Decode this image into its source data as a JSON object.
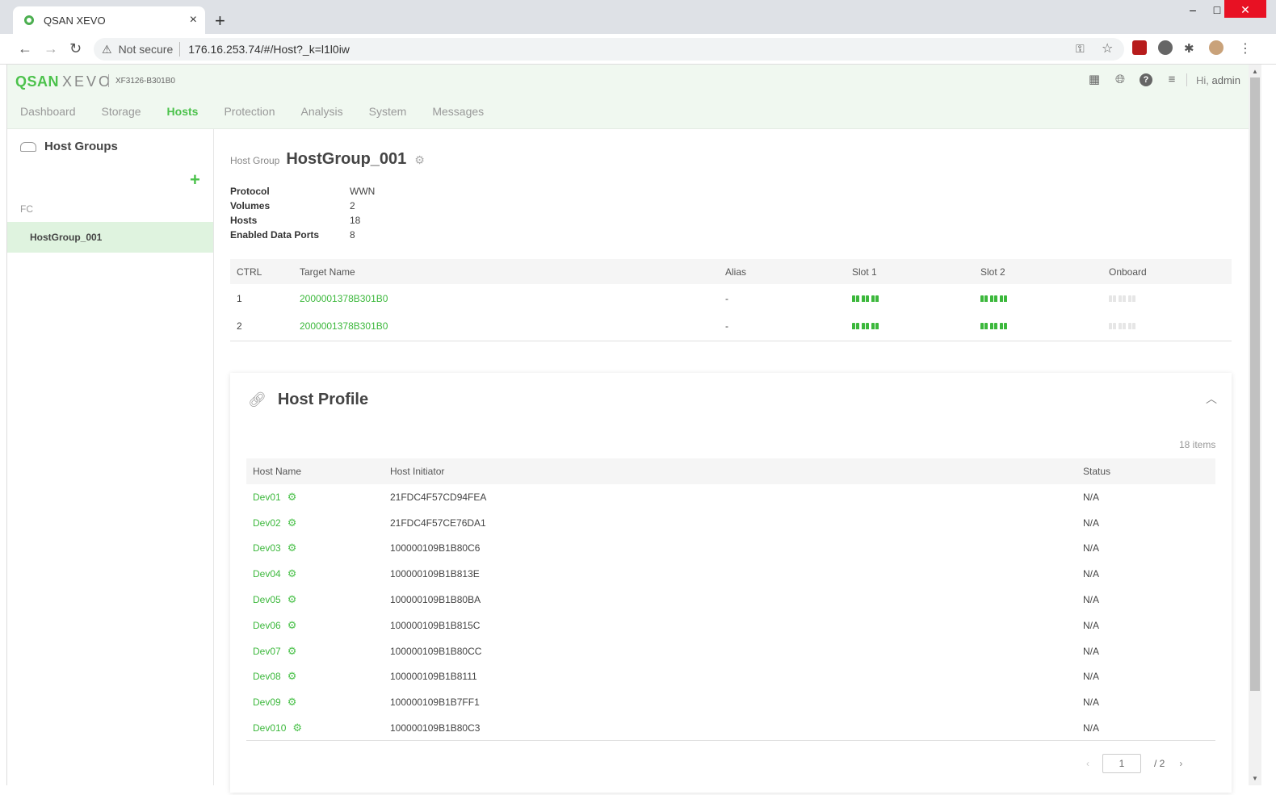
{
  "browser": {
    "tab_title": "QSAN XEVO",
    "new_tab": "+",
    "security": "Not secure",
    "url": "176.16.253.74/#/Host?_k=l1l0iw",
    "window_minimize": "–",
    "window_maximize": "□",
    "window_close": "✕"
  },
  "app": {
    "logo_brand": "QSAN",
    "logo_product": "XEVO",
    "model": "XF3126-B301B0",
    "greeting_prefix": "Hi,",
    "user": "admin",
    "nav": [
      "Dashboard",
      "Storage",
      "Hosts",
      "Protection",
      "Analysis",
      "System",
      "Messages"
    ],
    "active_nav": "Hosts",
    "accent_color": "#4cc24c"
  },
  "sidebar": {
    "title": "Host Groups",
    "add_label": "+",
    "section": "FC",
    "items": [
      {
        "label": "HostGroup_001",
        "selected": true
      }
    ]
  },
  "host_group": {
    "label": "Host Group",
    "name": "HostGroup_001",
    "properties": [
      {
        "key": "Protocol",
        "value": "WWN"
      },
      {
        "key": "Volumes",
        "value": "2"
      },
      {
        "key": "Hosts",
        "value": "18"
      },
      {
        "key": "Enabled Data Ports",
        "value": "8"
      }
    ]
  },
  "ctrl_table": {
    "headers": [
      "CTRL",
      "Target Name",
      "Alias",
      "Slot 1",
      "Slot 2",
      "Onboard"
    ],
    "rows": [
      {
        "ctrl": "1",
        "target": "2000001378B301B0",
        "alias": "-",
        "slot1": "enabled",
        "slot2": "enabled",
        "onboard": "disabled"
      },
      {
        "ctrl": "2",
        "target": "2000001378B301B0",
        "alias": "-",
        "slot1": "enabled",
        "slot2": "enabled",
        "onboard": "disabled"
      }
    ]
  },
  "host_profile": {
    "title": "Host Profile",
    "items_count": "18 items",
    "headers": [
      "Host Name",
      "Host Initiator",
      "Status"
    ],
    "rows": [
      {
        "name": "Dev01",
        "initiator": "21FDC4F57CD94FEA",
        "status": "N/A"
      },
      {
        "name": "Dev02",
        "initiator": "21FDC4F57CE76DA1",
        "status": "N/A"
      },
      {
        "name": "Dev03",
        "initiator": "100000109B1B80C6",
        "status": "N/A"
      },
      {
        "name": "Dev04",
        "initiator": "100000109B1B813E",
        "status": "N/A"
      },
      {
        "name": "Dev05",
        "initiator": "100000109B1B80BA",
        "status": "N/A"
      },
      {
        "name": "Dev06",
        "initiator": "100000109B1B815C",
        "status": "N/A"
      },
      {
        "name": "Dev07",
        "initiator": "100000109B1B80CC",
        "status": "N/A"
      },
      {
        "name": "Dev08",
        "initiator": "100000109B1B8111",
        "status": "N/A"
      },
      {
        "name": "Dev09",
        "initiator": "100000109B1B7FF1",
        "status": "N/A"
      },
      {
        "name": "Dev010",
        "initiator": "100000109B1B80C3",
        "status": "N/A"
      }
    ],
    "pager": {
      "prev": "‹",
      "current": "1",
      "total": "/ 2",
      "next": "›"
    }
  }
}
